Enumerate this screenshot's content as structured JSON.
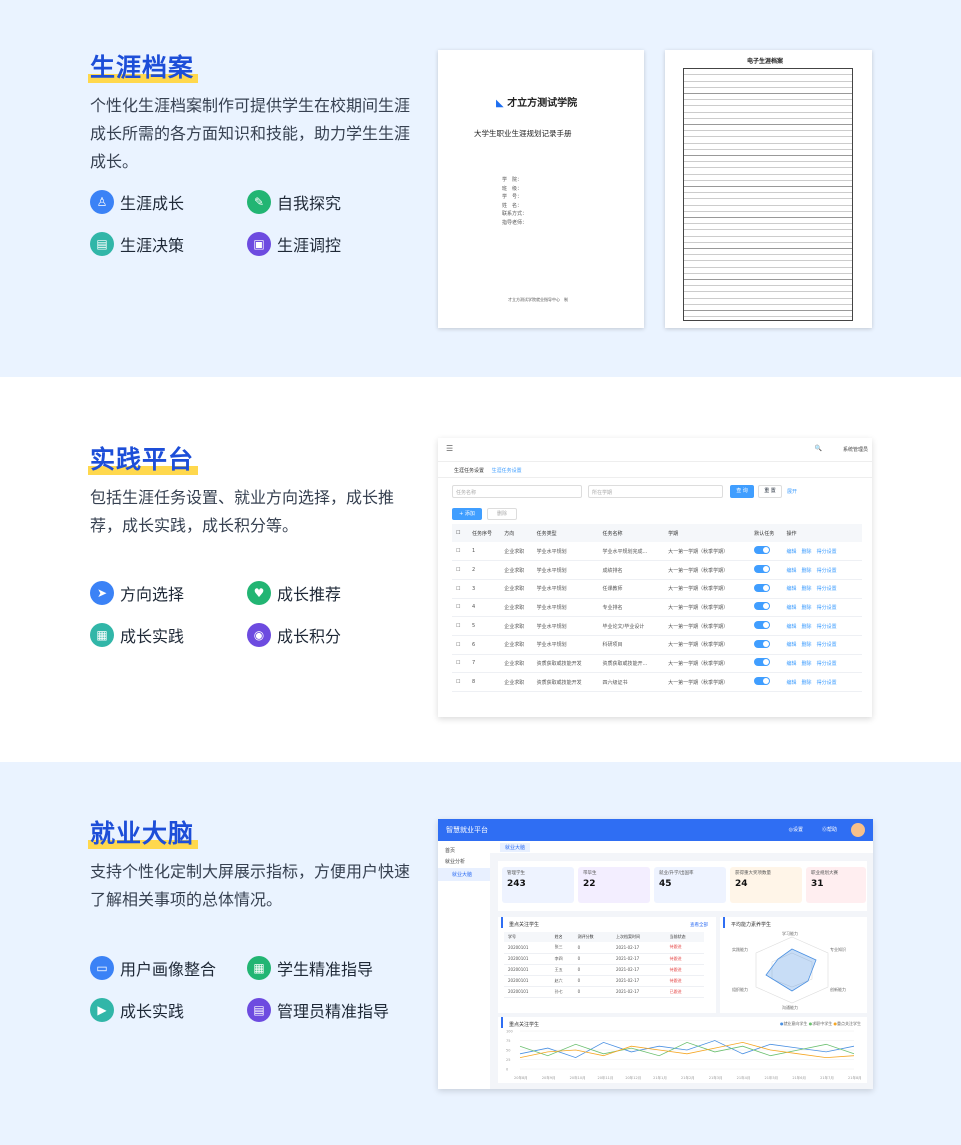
{
  "sections": [
    {
      "title": "生涯档案",
      "desc": "个性化生涯档案制作可提供学生在校期间生涯成长所需的各方面知识和技能，助力学生生涯成长。",
      "features": [
        {
          "label": "生涯成长",
          "icon": "user-growth-icon"
        },
        {
          "label": "自我探究",
          "icon": "explore-icon"
        },
        {
          "label": "生涯决策",
          "icon": "decision-icon"
        },
        {
          "label": "生涯调控",
          "icon": "control-icon"
        }
      ]
    },
    {
      "title": "实践平台",
      "desc": "包括生涯任务设置、就业方向选择，成长推荐，成长实践，成长积分等。",
      "features": [
        {
          "label": "方向选择",
          "icon": "send-icon"
        },
        {
          "label": "成长推荐",
          "icon": "recommend-icon"
        },
        {
          "label": "成长实践",
          "icon": "practice-icon"
        },
        {
          "label": "成长积分",
          "icon": "points-icon"
        }
      ]
    },
    {
      "title": "就业大脑",
      "desc": "支持个性化定制大屏展示指标，方便用户快速了解相关事项的总体情况。",
      "features": [
        {
          "label": "用户画像整合",
          "icon": "profile-icon"
        },
        {
          "label": "学生精准指导",
          "icon": "guide-icon"
        },
        {
          "label": "成长实践",
          "icon": "practice-icon"
        },
        {
          "label": "管理员精准指导",
          "icon": "admin-icon"
        }
      ]
    }
  ],
  "doc": {
    "school": "才立方测试学院",
    "book_title": "大学生职业生涯规划记录手册",
    "fields": [
      "学　院：",
      "班　级：",
      "学　号：",
      "姓　名：",
      "联系方式：",
      "指导老师："
    ],
    "publisher": "才立方测试学院就业指导中心　制",
    "page2_title": "电子生涯档案"
  },
  "practice": {
    "tabs": [
      "生涯任务设置",
      "生涯任务设置"
    ],
    "user": "系统管理员",
    "search_placeholder": "任务名称",
    "select_placeholder": "所在学期",
    "query": "查 询",
    "reset": "重 置",
    "expand": "展开",
    "add": "+ 添加",
    "delete": "删除",
    "columns": [
      "任务序号",
      "方向",
      "任务类型",
      "任务名称",
      "学期",
      "默认任务",
      "操作"
    ],
    "rows": [
      [
        "1",
        "企业求职",
        "学业水平规划",
        "学业水平规划完成...",
        "大一第一学期（秋季学期）"
      ],
      [
        "2",
        "企业求职",
        "学业水平规划",
        "成绩排名",
        "大一第一学期（秋季学期）"
      ],
      [
        "3",
        "企业求职",
        "学业水平规划",
        "任课教师",
        "大一第一学期（秋季学期）"
      ],
      [
        "4",
        "企业求职",
        "学业水平规划",
        "专业排名",
        "大一第一学期（秋季学期）"
      ],
      [
        "5",
        "企业求职",
        "学业水平规划",
        "毕业论文/毕业设计",
        "大一第一学期（秋季学期）"
      ],
      [
        "6",
        "企业求职",
        "学业水平规划",
        "科研项目",
        "大一第一学期（秋季学期）"
      ],
      [
        "7",
        "企业求职",
        "资质获取或技能开发",
        "资质获取或技能开...",
        "大一第一学期（秋季学期）"
      ],
      [
        "8",
        "企业求职",
        "资质获取或技能开发",
        "四六级证书",
        "大一第一学期（秋季学期）"
      ]
    ],
    "ops": [
      "编辑",
      "删除",
      "得分设置"
    ]
  },
  "brain": {
    "app": "智慧就业平台",
    "header_right": [
      "◎设置",
      "⓪帮助"
    ],
    "nav": [
      "首页",
      "就业分析",
      "就业大脑"
    ],
    "tab": "就业大脑",
    "cards": [
      {
        "label": "管理学生",
        "value": "243"
      },
      {
        "label": "带毕生",
        "value": "22"
      },
      {
        "label": "就业/升学/出国率",
        "value": "45"
      },
      {
        "label": "获得重大奖项数量",
        "value": "24"
      },
      {
        "label": "职业规划大赛",
        "value": "31"
      }
    ],
    "table_title": "重点关注学生",
    "table_more": "查看全部",
    "table_cols": [
      "学号",
      "姓名",
      "测评分数",
      "上次档案时间",
      "当前状态"
    ],
    "table_rows": [
      [
        "20200101",
        "张三",
        "0",
        "2021-02-17",
        "待跟进"
      ],
      [
        "20200101",
        "李四",
        "0",
        "2021-02-17",
        "待跟进"
      ],
      [
        "20200101",
        "王五",
        "0",
        "2021-02-17",
        "待跟进"
      ],
      [
        "20200101",
        "赵六",
        "0",
        "2021-02-17",
        "待跟进"
      ],
      [
        "20200101",
        "孙七",
        "0",
        "2021-02-17",
        "已跟进"
      ]
    ],
    "radar_title": "平均能力素养学生",
    "radar_labels": [
      "学习能力",
      "专业知识",
      "创新能力",
      "沟通能力",
      "组织能力",
      "实践能力"
    ],
    "line_title": "重点关注学生",
    "legend": [
      "就业意向学生",
      "求职中学生",
      "重点关注学生"
    ],
    "x": [
      "20年8月",
      "20年9月",
      "20年10月",
      "20年11月",
      "20年12月",
      "21年1月",
      "21年2月",
      "21年3月",
      "21年4月",
      "21年5月",
      "21年6月",
      "21年7月",
      "21年8月"
    ]
  },
  "chart_data": {
    "type": "line",
    "categories": [
      "20年8月",
      "20年9月",
      "20年10月",
      "20年11月",
      "20年12月",
      "21年1月",
      "21年2月",
      "21年3月",
      "21年4月",
      "21年5月",
      "21年6月",
      "21年7月",
      "21年8月"
    ],
    "ylim": [
      0,
      100
    ],
    "series": [
      {
        "name": "就业意向学生",
        "values": [
          40,
          55,
          30,
          70,
          45,
          60,
          50,
          75,
          40,
          65,
          55,
          45,
          60
        ]
      },
      {
        "name": "求职中学生",
        "values": [
          60,
          35,
          65,
          40,
          55,
          35,
          70,
          45,
          60,
          35,
          50,
          65,
          40
        ]
      },
      {
        "name": "重点关注学生",
        "values": [
          30,
          45,
          50,
          35,
          60,
          50,
          40,
          55,
          70,
          50,
          40,
          30,
          35
        ]
      }
    ],
    "colors": [
      "#4a90e2",
      "#6cc070",
      "#f5a623"
    ]
  }
}
